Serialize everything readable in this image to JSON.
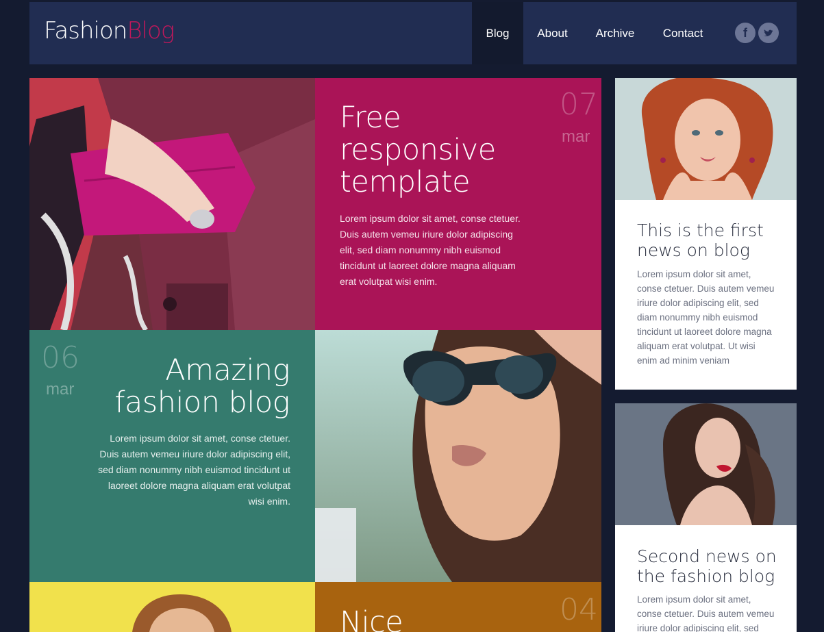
{
  "brand": {
    "logo_main": "Fashion",
    "logo_accent": "Blog",
    "accent_color": "#c2185b"
  },
  "nav": {
    "items": [
      {
        "label": "Blog",
        "active": true
      },
      {
        "label": "About",
        "active": false
      },
      {
        "label": "Archive",
        "active": false
      },
      {
        "label": "Contact",
        "active": false
      }
    ],
    "social": [
      {
        "icon": "facebook-icon",
        "glyph": "f"
      },
      {
        "icon": "twitter-icon",
        "glyph": "t"
      }
    ]
  },
  "posts": [
    {
      "day": "07",
      "month": "mar",
      "title_lines": [
        "Free",
        "responsive",
        "template"
      ],
      "text": "Lorem ipsum dolor sit amet, conse ctetuer. Duis autem vemeu iriure dolor adipiscing elit, sed diam nonummy nibh euismod tincidunt ut laoreet dolore magna aliquam erat volutpat wisi enim.",
      "color": "#aa1457"
    },
    {
      "day": "06",
      "month": "mar",
      "title_lines": [
        "Amazing",
        "fashion blog"
      ],
      "text": "Lorem ipsum dolor sit amet, conse ctetuer. Duis autem vemeu iriure dolor adipiscing elit, sed diam nonummy nibh euismod tincidunt ut laoreet dolore magna aliquam erat volutpat wisi enim.",
      "color": "#357b6e"
    },
    {
      "day": "04",
      "month": "",
      "title_lines": [
        "Nice"
      ],
      "text": "",
      "color": "#a8630f"
    }
  ],
  "sidebar": [
    {
      "title": "This is the first news on blog",
      "text": "Lorem ipsum dolor sit amet, conse ctetuer. Duis autem vemeu iriure dolor adipiscing elit, sed diam nonummy nibh euismod tincidunt ut laoreet dolore magna aliquam erat volutpat. Ut wisi enim ad minim veniam"
    },
    {
      "title": "Second news on the fashion blog",
      "text": "Lorem ipsum dolor sit amet, conse ctetuer. Duis autem vemeu iriure dolor adipiscing elit, sed"
    }
  ]
}
